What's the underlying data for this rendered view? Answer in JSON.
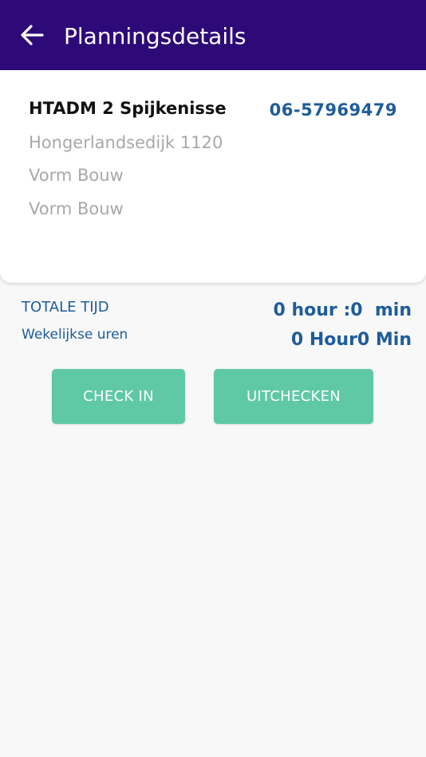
{
  "header": {
    "title": "Planningsdetails",
    "back_icon": "arrow-left-icon",
    "background": "#2e0a78"
  },
  "card": {
    "name": "HTADM 2 Spijkenisse",
    "phone": "06-57969479",
    "address": "Hongerlandsedijk 1120",
    "company": "Vorm Bouw",
    "location": "Vorm Bouw"
  },
  "stats": {
    "total_time_label": "TOTALE TIJD",
    "total_time_value": "0 hour :0  min",
    "weekly_label": "Wekelijkse uren",
    "weekly_value": "0 Hour0 Min"
  },
  "actions": {
    "check_in_label": "CHECK IN",
    "check_out_label": "UITCHECKEN",
    "button_color": "#5ec9a4"
  },
  "colors": {
    "accent_text": "#1e5c9a",
    "muted_text": "#a8a8a8"
  }
}
